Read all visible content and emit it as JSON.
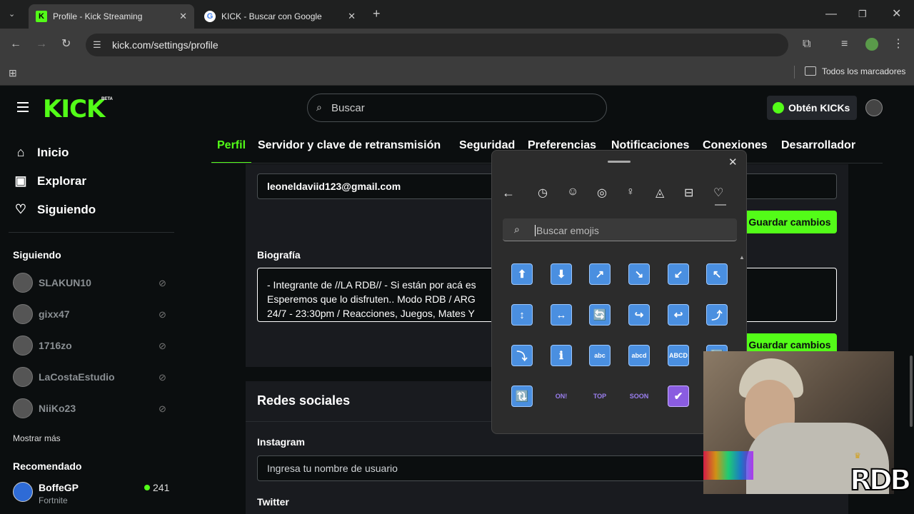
{
  "browser": {
    "tabs": [
      {
        "title": "Profile - Kick Streaming",
        "active": true
      },
      {
        "title": "KICK - Buscar con Google",
        "active": false
      }
    ],
    "new_tab_icon": "+",
    "url": "kick.com/settings/profile",
    "bookmarks_label": "Todos los marcadores"
  },
  "header": {
    "logo": "KICK",
    "logo_badge": "BETA",
    "search_placeholder": "Buscar",
    "kicks_button": "Obtén KICKs"
  },
  "sidebar": {
    "nav": [
      {
        "label": "Inicio",
        "icon": "home-icon"
      },
      {
        "label": "Explorar",
        "icon": "explore-icon"
      },
      {
        "label": "Siguiendo",
        "icon": "heart-icon"
      }
    ],
    "following_title": "Siguiendo",
    "following": [
      "SLAKUN10",
      "gixx47",
      "1716zo",
      "LaCostaEstudio",
      "NiiKo23"
    ],
    "show_more": "Mostrar más",
    "recommended_title": "Recomendado",
    "recommended": [
      {
        "name": "BoffeGP",
        "category": "Fortnite",
        "viewers": "241"
      }
    ]
  },
  "settings": {
    "tabs": [
      "Perfil",
      "Servidor y clave de retransmisión",
      "Seguridad",
      "Preferencias",
      "Notificaciones",
      "Conexiones",
      "Desarrollador"
    ],
    "email_value": "leoneldaviid123@gmail.com",
    "save_label": "Guardar cambios",
    "bio_label": "Biografía",
    "bio_lines": [
      "- Integrante de //LA RDB// -  Si están por acá es",
      "Esperemos que lo disfruten..  Modo RDB / ARG",
      "24/7 - 23:30pm / Reacciones, Juegos, Mates Y"
    ],
    "social_title": "Redes sociales",
    "instagram_label": "Instagram",
    "instagram_placeholder": "Ingresa tu nombre de usuario",
    "twitter_label": "Twitter"
  },
  "emoji_panel": {
    "search_placeholder": "Buscar emojis",
    "rows": [
      [
        "⬆",
        "⬇",
        "↗",
        "↘",
        "↙",
        "↖"
      ],
      [
        "↕",
        "↔",
        "🔄",
        "↪",
        "↩",
        "⤴"
      ],
      [
        "⤵",
        "ℹ",
        "abc",
        "abcd",
        "ABCD",
        "🔤"
      ],
      [
        "🔃",
        "ON!",
        "TOP",
        "SOON",
        "✔"
      ]
    ]
  },
  "overlay_logo": "RDB"
}
